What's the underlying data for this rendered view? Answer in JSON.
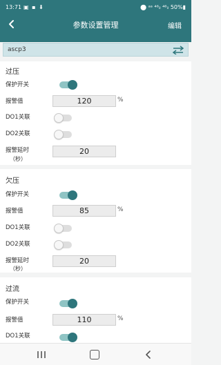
{
  "status_bar": {
    "time": "13:71",
    "left_icons": "▣ ▪ ⬇",
    "right_icons": "⬤ ᵃᵃ ⁴⁶ᵢₗ ⁴⁶ᵢₗ 50%▮"
  },
  "header": {
    "title": "参数设置管理",
    "edit_label": "编辑",
    "back_icon": "chevron-left-icon"
  },
  "device": {
    "name": "ascp3",
    "switch_icon": "swap-arrows-icon"
  },
  "colors": {
    "primary": "#2e767c",
    "toggle_track_on": "#8fc4c4",
    "device_bar": "#cfe4e8"
  },
  "sections": [
    {
      "title": "过压",
      "protect_label": "保护开关",
      "protect_on": true,
      "alarm_label": "报警值",
      "alarm_value": "120",
      "unit": "%",
      "do1_label": "DO1关联",
      "do1_on": false,
      "do2_label": "DO2关联",
      "do2_on": false,
      "delay_label": "报警延时",
      "delay_sub": "（秒）",
      "delay_value": "20"
    },
    {
      "title": "欠压",
      "protect_label": "保护开关",
      "protect_on": true,
      "alarm_label": "报警值",
      "alarm_value": "85",
      "unit": "%",
      "do1_label": "DO1关联",
      "do1_on": false,
      "do2_label": "DO2关联",
      "do2_on": false,
      "delay_label": "报警延时",
      "delay_sub": "（秒）",
      "delay_value": "20"
    },
    {
      "title": "过流",
      "protect_label": "保护开关",
      "protect_on": true,
      "alarm_label": "报警值",
      "alarm_value": "110",
      "unit": "%",
      "do1_label": "DO1关联",
      "do1_on": true
    }
  ],
  "navbar": {
    "recent_icon": "recent-apps-icon",
    "home_icon": "home-icon",
    "back_icon": "back-triangle-icon"
  }
}
